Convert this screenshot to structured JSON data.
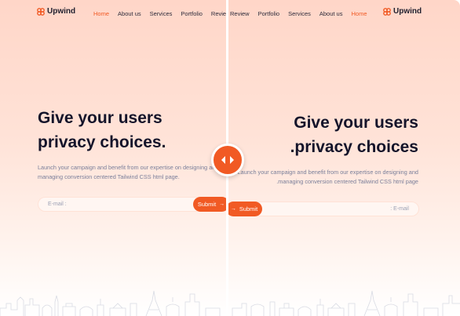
{
  "brand": {
    "name": "Upwind",
    "accent": "#f15a24"
  },
  "ltr": {
    "nav": [
      "Home",
      "About us",
      "Services",
      "Portfolio",
      "Review"
    ],
    "title_line1": "Give your users",
    "title_line2": "privacy choices.",
    "desc_line1": "Launch your campaign and benefit from our expertise on designing and",
    "desc_line2": "managing conversion centered Tailwind CSS html page.",
    "email_placeholder": "E-mail :",
    "submit_label": "Submit"
  },
  "rtl": {
    "nav": [
      "Review",
      "Portfolio",
      "Services",
      "About us",
      "Home"
    ],
    "title_line1": "Give your users",
    "title_line2": ".privacy choices",
    "desc_line1": "Launch your campaign and benefit from our expertise on designing and",
    "desc_line2": ".managing conversion centered Tailwind CSS html page",
    "email_placeholder": ": E-mail",
    "submit_label": "Submit"
  },
  "icons": {
    "logo": "upwind-logo-icon",
    "arrow": "arrow-right-icon",
    "handle": "compare-handle-icon"
  }
}
